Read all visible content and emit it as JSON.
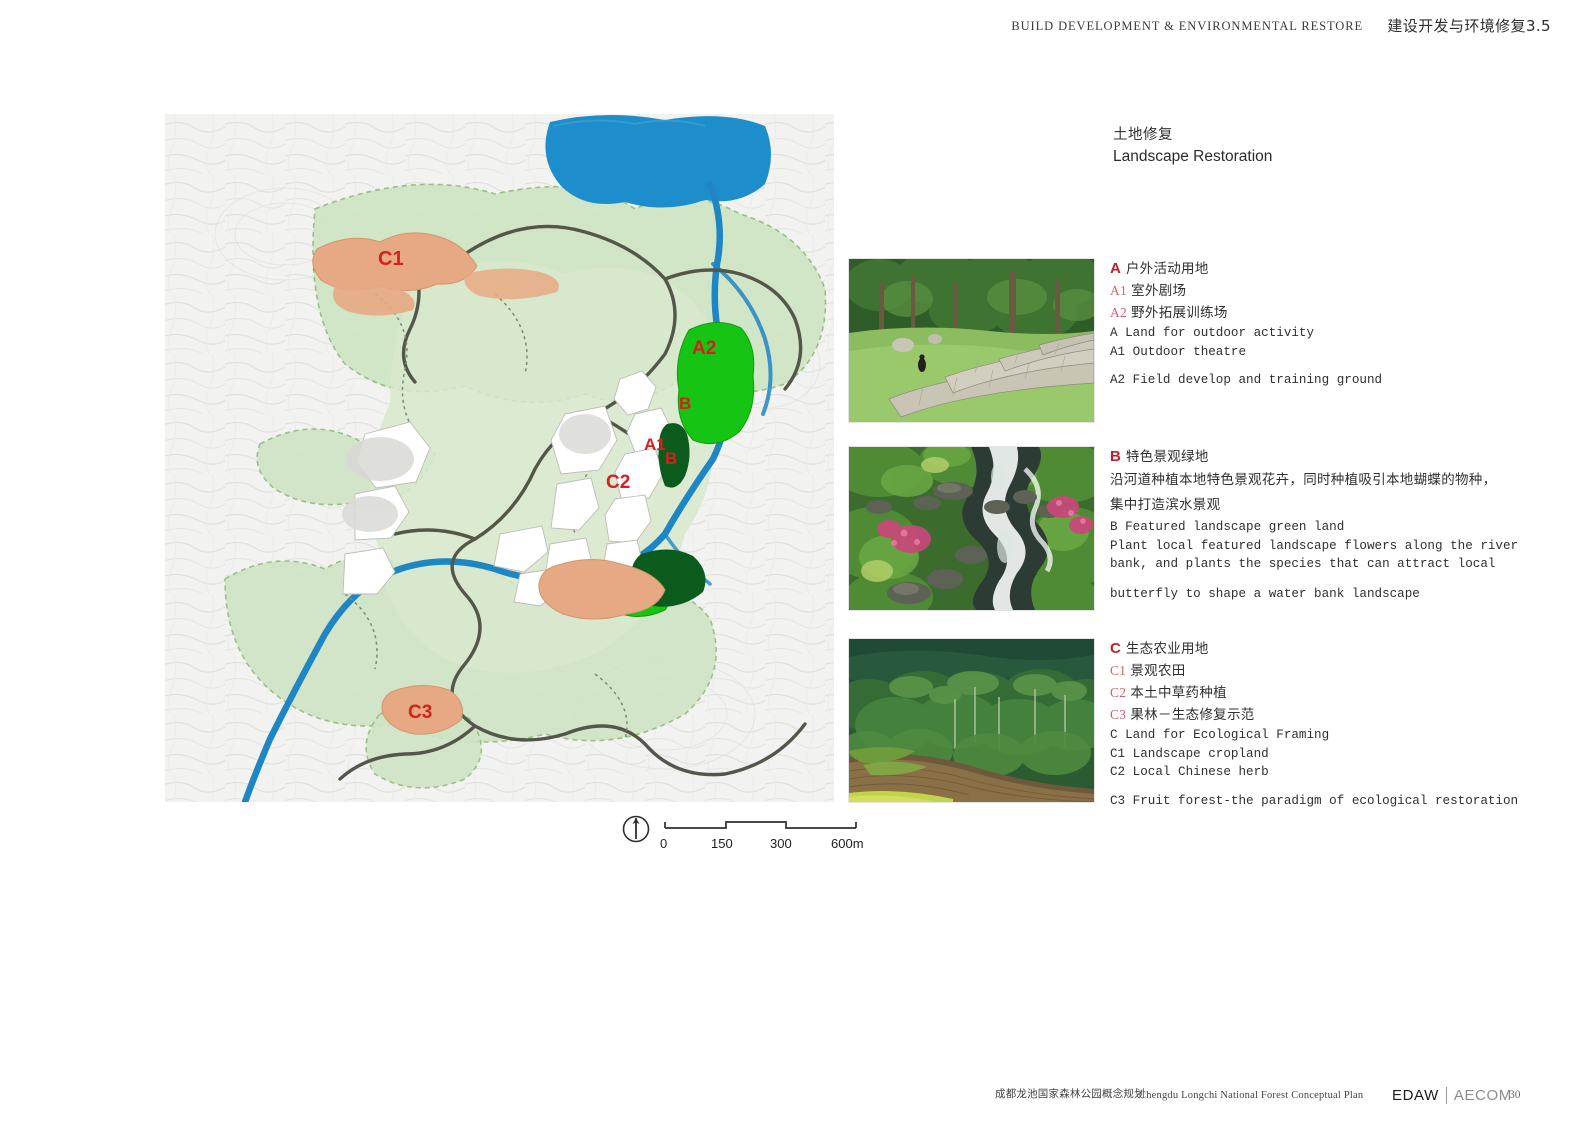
{
  "header": {
    "english": "BUILD DEVELOPMENT & ENVIRONMENTAL RESTORE",
    "chinese": "建设开发与环境修复3.5"
  },
  "section": {
    "title_cn": "土地修复",
    "title_en": "Landscape Restoration"
  },
  "map": {
    "alt": "Conceptual land-use restoration plan with lake, river, forest zones and lettered restoration areas",
    "zone_labels": [
      "C1",
      "A2",
      "B",
      "A1",
      "B",
      "C2",
      "C3"
    ],
    "colors": {
      "lake": "#1d8ecb",
      "river": "#1f86c4",
      "activity_green": "#16c513",
      "featured_dark_green": "#0b5c1c",
      "agriculture_tan": "#e7a983",
      "forest_pale": "#cfe4c4",
      "base": "#f1f1ef",
      "road": "#55564a",
      "label_red": "#d4211e"
    }
  },
  "scale": {
    "ticks": [
      "0",
      "150",
      "300",
      "600m"
    ],
    "north_label": "N"
  },
  "blocks": [
    {
      "key": "A",
      "letter": "A",
      "photo_name": "photo-outdoor-theatre",
      "lines_cn": [
        {
          "code": "A",
          "text": "户外活动用地",
          "head": true
        },
        {
          "code": "A1",
          "text": "室外剧场",
          "head": false
        },
        {
          "code": "A2",
          "text": "野外拓展训练场",
          "head": false
        }
      ],
      "lines_en": [
        "A Land for outdoor activity",
        "A1 Outdoor theatre",
        "A2 Field develop and training ground"
      ]
    },
    {
      "key": "B",
      "letter": "B",
      "photo_name": "photo-stream-wildflowers",
      "lines_cn": [
        {
          "code": "B",
          "text": "特色景观绿地",
          "head": true
        }
      ],
      "paragraph_cn": "沿河道种植本地特色景观花卉，同时种植吸引本地蝴蝶的物种，集中打造滨水景观",
      "lines_en": [
        "B Featured landscape green land",
        "Plant local featured landscape flowers along the river",
        "bank, and plants the species that can attract local",
        "butterfly to shape a water bank landscape"
      ]
    },
    {
      "key": "C",
      "letter": "C",
      "photo_name": "photo-forest-terraced-farm",
      "lines_cn": [
        {
          "code": "C",
          "text": "生态农业用地",
          "head": true
        },
        {
          "code": "C1",
          "text": "景观农田",
          "head": false
        },
        {
          "code": "C2",
          "text": "本土中草药种植",
          "head": false
        },
        {
          "code": "C3",
          "text": "果林－生态修复示范",
          "head": false
        }
      ],
      "lines_en": [
        "C Land for Ecological Framing",
        "C1 Landscape cropland",
        "C2 Local Chinese herb",
        "C3 Fruit forest-the paradigm of ecological restoration"
      ]
    }
  ],
  "footer": {
    "cn": "成都龙池国家森林公园概念规划",
    "en": "Chengdu Longchi National Forest Conceptual Plan",
    "logo_primary": "EDAW",
    "logo_secondary": "AECOM",
    "page": "30"
  }
}
